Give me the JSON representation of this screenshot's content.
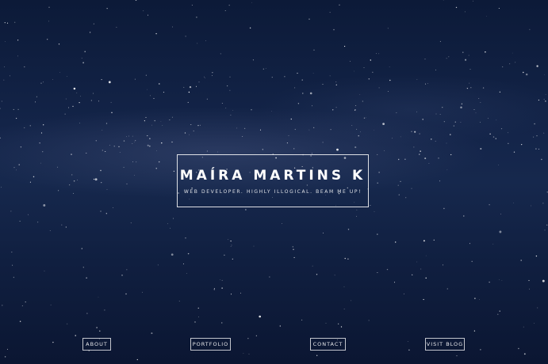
{
  "hero": {
    "name": "MAÍRA MARTINS K",
    "tagline": "WEB DEVELOPER. HIGHLY ILLOGICAL. BEAM ME UP!"
  },
  "nav": {
    "about_label": "ABOUT",
    "portfolio_label": "PORTFOLIO",
    "contact_label": "CONTACT",
    "blog_label": "VISIT BLOG"
  },
  "colors": {
    "background": "#0d1730",
    "text": "#ffffff"
  }
}
